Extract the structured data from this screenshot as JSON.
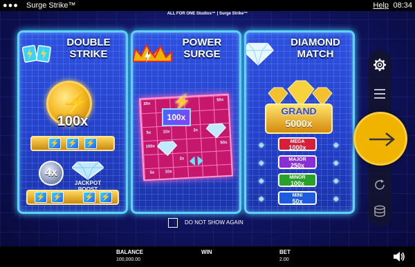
{
  "topbar": {
    "title": "Surge Strike™",
    "help_label": "Help",
    "clock": "08:34",
    "menu_icon": "three-dots-icon"
  },
  "studio_text": "ALL FOR ONE Studios™ | Surge Strike™",
  "panels": [
    {
      "title_line1": "DOUBLE",
      "title_line2": "STRIKE",
      "multiplier": "100x",
      "orb_multiplier": "4x",
      "jackpot_line1": "JACKPOT",
      "jackpot_line2": "BOOST"
    },
    {
      "title_line1": "POWER",
      "title_line2": "SURGE",
      "reel_multiplier": "100x",
      "cell_values": [
        "20x",
        "50x",
        "5x",
        "10x",
        "2x",
        "50x",
        "100x",
        "2x",
        "5x",
        "10x"
      ]
    },
    {
      "title_line1": "DIAMOND",
      "title_line2": "MATCH",
      "grand_label": "GRAND",
      "grand_value": "5000x",
      "jackpots": [
        {
          "name": "MEGA",
          "value": "1000x"
        },
        {
          "name": "MAJOR",
          "value": "250x"
        },
        {
          "name": "MINOR",
          "value": "100x"
        },
        {
          "name": "MINI",
          "value": "50x"
        }
      ]
    }
  ],
  "dont_show_label": "DO NOT SHOW AGAIN",
  "bottom": {
    "balance_label": "BALANCE",
    "balance_value": "100,000.00",
    "win_label": "WIN",
    "bet_label": "BET",
    "bet_value": "2.00"
  },
  "controls": {
    "settings_icon": "gear-icon",
    "menu_icon": "hamburger-icon",
    "spin_icon": "arrow-right-icon",
    "autoplay_icon": "autoplay-icon",
    "stake_icon": "coin-stack-icon",
    "sound_icon": "speaker-icon"
  },
  "colors": {
    "panel_border": "#5fd2ff",
    "spin_button": "#f0b400",
    "mega": "#d81f3a",
    "major": "#8a2fd6",
    "minor": "#27a12a",
    "mini": "#1d5be0"
  }
}
